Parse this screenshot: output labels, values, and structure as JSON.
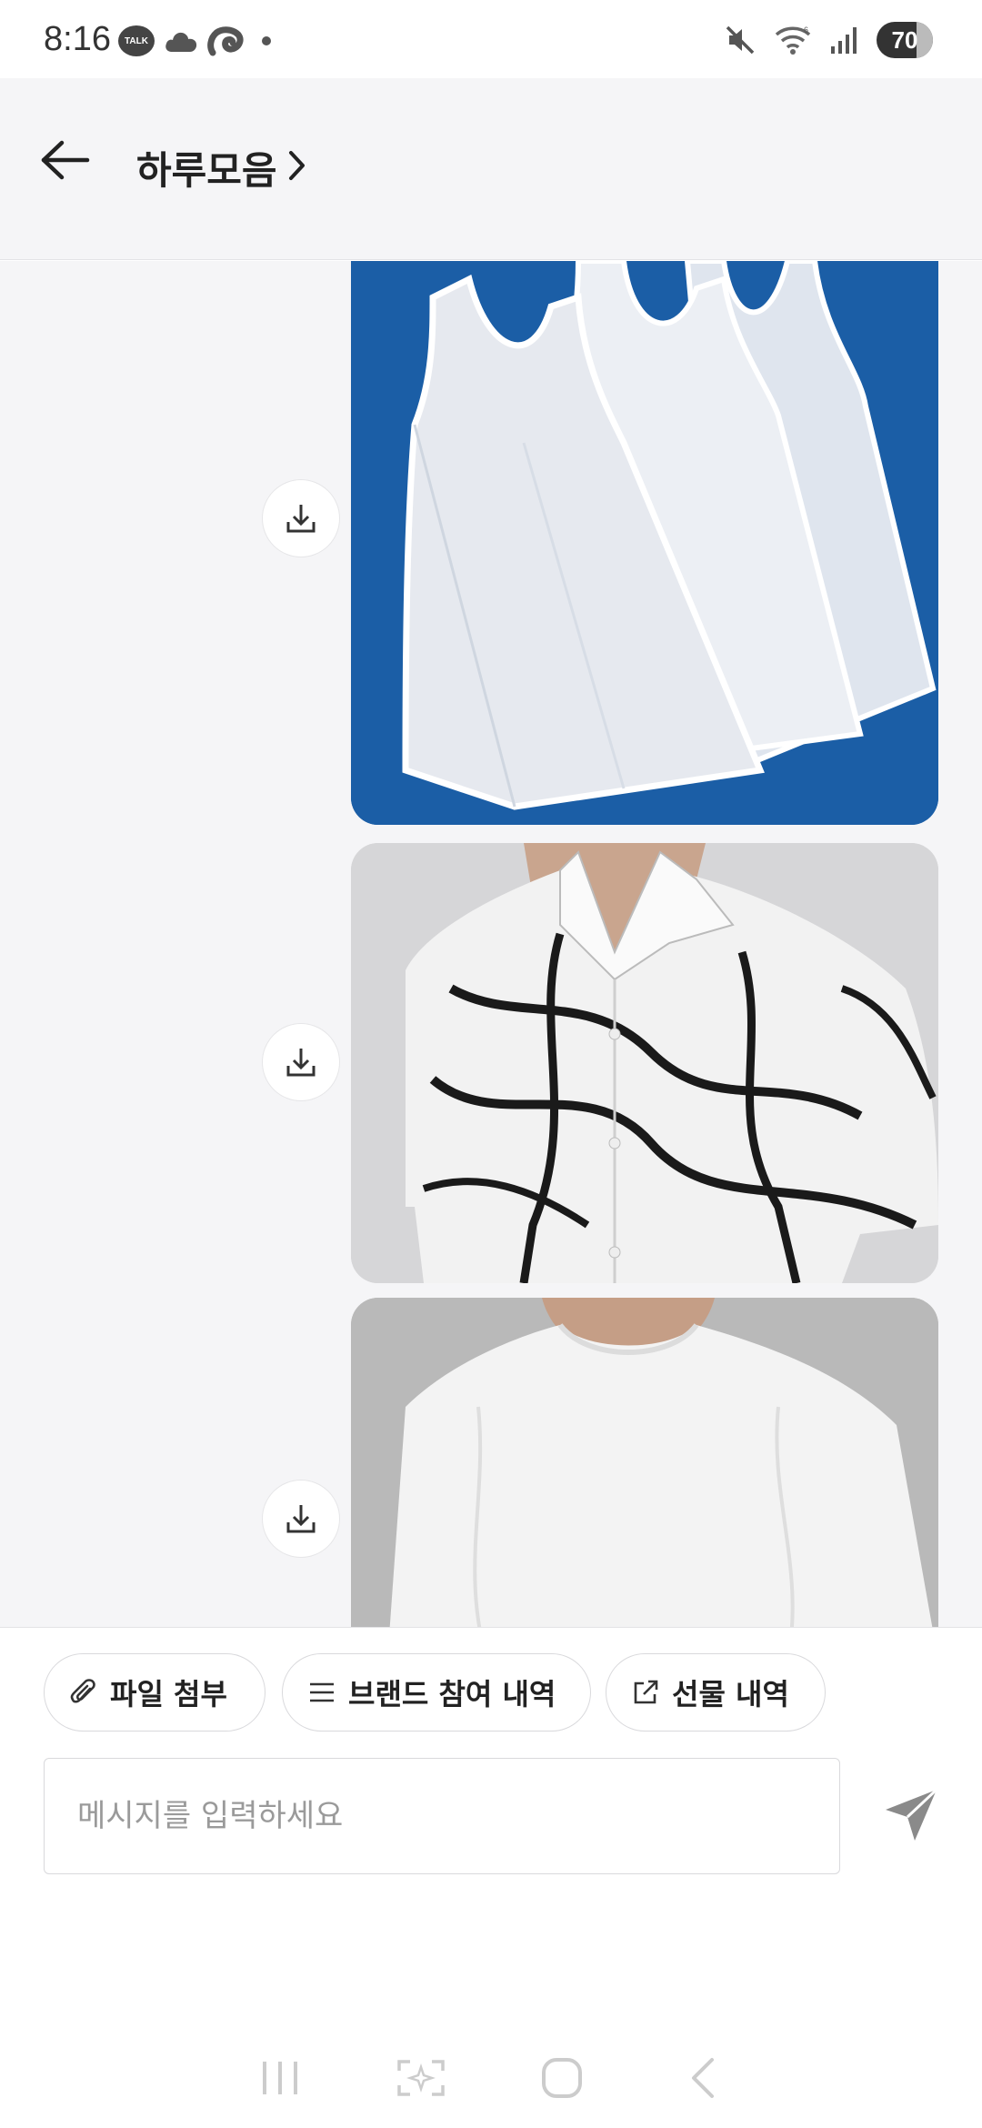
{
  "status_bar": {
    "time": "8:16",
    "talk_badge": "TALK",
    "battery": "70",
    "icons": [
      "kakaotalk-icon",
      "cloud-icon",
      "thread-icon",
      "notification-dot",
      "mute-icon",
      "wifi-icon",
      "signal-icon",
      "battery-icon"
    ]
  },
  "header": {
    "title": "하루모음",
    "back_icon": "back-arrow-icon",
    "chevron_icon": "chevron-right-icon"
  },
  "chat": {
    "messages": [
      {
        "type": "image",
        "subject": "white tank tops on blue background",
        "download_icon": "download-icon"
      },
      {
        "type": "image",
        "subject": "white shirt with black line pattern",
        "download_icon": "download-icon"
      },
      {
        "type": "image",
        "subject": "white t-shirt",
        "download_icon": "download-icon"
      }
    ]
  },
  "composer": {
    "chips": [
      {
        "label": "파일 첨부",
        "icon": "paperclip-icon"
      },
      {
        "label": "브랜드 참여 내역",
        "icon": "list-icon"
      },
      {
        "label": "선물 내역",
        "icon": "external-link-icon"
      }
    ],
    "input_placeholder": "메시지를 입력하세요",
    "send_icon": "send-icon"
  },
  "nav_bar": {
    "icons": [
      "recent-apps-icon",
      "bixby-capture-icon",
      "home-icon",
      "back-icon"
    ]
  },
  "colors": {
    "header_bg": "#f5f5f7",
    "chat_bg": "#f5f5f7",
    "tank_photo_bg": "#1a5aa0",
    "send_icon": "#888888"
  }
}
